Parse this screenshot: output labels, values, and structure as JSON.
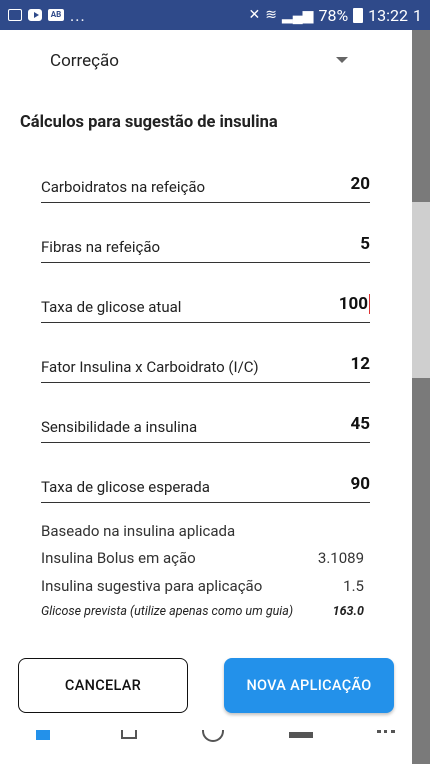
{
  "status_bar": {
    "left_icons": [
      "image-icon",
      "youtube-icon",
      "app-icon"
    ],
    "app_icon_text": "AB",
    "overflow": "...",
    "battery_percent": "78%",
    "time": "13:22",
    "sim": "1"
  },
  "dropdown": {
    "value": "Correção"
  },
  "section_title": "Cálculos para sugestão de insulina",
  "fields": [
    {
      "label": "Carboidratos na refeição",
      "value": "20"
    },
    {
      "label": "Fibras na refeição",
      "value": "5"
    },
    {
      "label": "Taxa de glicose atual",
      "value": "100"
    },
    {
      "label": "Fator Insulina x Carboidrato (I/C)",
      "value": "12"
    },
    {
      "label": "Sensibilidade a insulina",
      "value": "45"
    },
    {
      "label": "Taxa de glicose esperada",
      "value": "90"
    }
  ],
  "summary": {
    "based_on": "Baseado na insulina aplicada",
    "bolus_label": "Insulina Bolus em ação",
    "bolus_value": "3.1089",
    "suggested_label": "Insulina sugestiva para aplicação",
    "suggested_value": "1.5",
    "predicted_label": "Glicose prevista (utilize apenas como um guia)",
    "predicted_value": "163.0"
  },
  "buttons": {
    "cancel": "CANCELAR",
    "new_application": "NOVA APLICAÇÃO"
  },
  "colors": {
    "primary": "#2391ea",
    "status_bar": "#2f4a8a"
  }
}
